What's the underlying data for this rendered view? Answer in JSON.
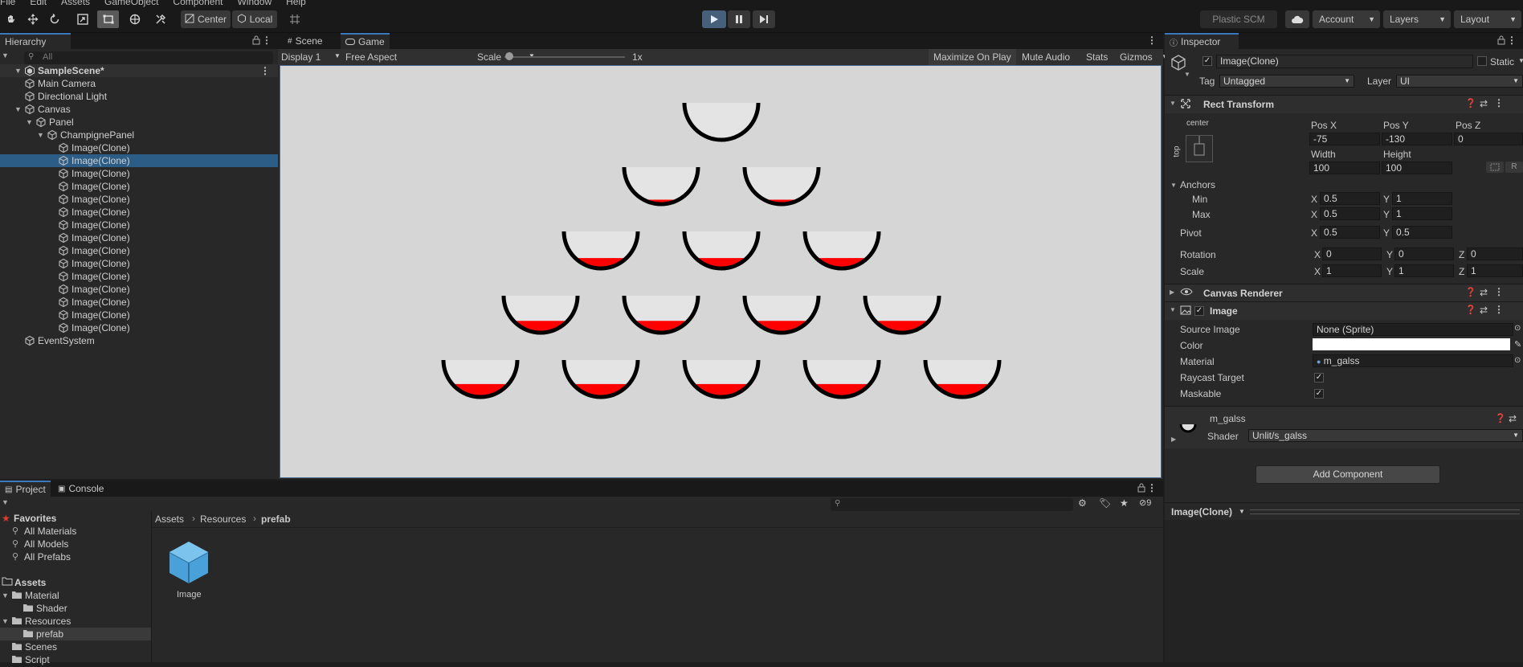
{
  "menubar": {
    "items": [
      "File",
      "Edit",
      "Assets",
      "GameObject",
      "Component",
      "Window",
      "Help"
    ]
  },
  "toolbar": {
    "pivot_center": "Center",
    "pivot_local": "Local",
    "plastic": "Plastic SCM",
    "account": "Account",
    "layers": "Layers",
    "layout": "Layout",
    "play_active": true
  },
  "hierarchy": {
    "tab": "Hierarchy",
    "search_placeholder": "All",
    "scene": "SampleScene*",
    "items": [
      {
        "label": "Main Camera",
        "depth": 1
      },
      {
        "label": "Directional Light",
        "depth": 1
      },
      {
        "label": "Canvas",
        "depth": 1
      },
      {
        "label": "Panel",
        "depth": 2
      },
      {
        "label": "ChampignePanel",
        "depth": 3
      },
      {
        "label": "Image(Clone)",
        "depth": 4
      },
      {
        "label": "Image(Clone)",
        "depth": 4,
        "selected": true
      },
      {
        "label": "Image(Clone)",
        "depth": 4
      },
      {
        "label": "Image(Clone)",
        "depth": 4
      },
      {
        "label": "Image(Clone)",
        "depth": 4
      },
      {
        "label": "Image(Clone)",
        "depth": 4
      },
      {
        "label": "Image(Clone)",
        "depth": 4
      },
      {
        "label": "Image(Clone)",
        "depth": 4
      },
      {
        "label": "Image(Clone)",
        "depth": 4
      },
      {
        "label": "Image(Clone)",
        "depth": 4
      },
      {
        "label": "Image(Clone)",
        "depth": 4
      },
      {
        "label": "Image(Clone)",
        "depth": 4
      },
      {
        "label": "Image(Clone)",
        "depth": 4
      },
      {
        "label": "Image(Clone)",
        "depth": 4
      },
      {
        "label": "Image(Clone)",
        "depth": 4
      },
      {
        "label": "EventSystem",
        "depth": 1
      }
    ]
  },
  "scene_view": {
    "tabs": [
      "Scene",
      "Game"
    ],
    "display": "Display 1",
    "aspect": "Free Aspect",
    "scale_label": "Scale",
    "scale_value": "1x",
    "maximize": "Maximize On Play",
    "mute": "Mute Audio",
    "stats": "Stats",
    "gizmos": "Gizmos",
    "glass_rows": [
      [
        0.0
      ],
      [
        0.12,
        0.12
      ],
      [
        0.28,
        0.28,
        0.28
      ],
      [
        0.32,
        0.32,
        0.32,
        0.32
      ],
      [
        0.35,
        0.35,
        0.35,
        0.35,
        0.35
      ]
    ]
  },
  "project": {
    "tabs": [
      "Project",
      "Console"
    ],
    "favorites_title": "Favorites",
    "favorites": [
      "All Materials",
      "All Models",
      "All Prefabs"
    ],
    "assets_title": "Assets",
    "tree": [
      {
        "label": "Material",
        "depth": 1
      },
      {
        "label": "Shader",
        "depth": 2
      },
      {
        "label": "Resources",
        "depth": 1
      },
      {
        "label": "prefab",
        "depth": 2,
        "selected": true
      },
      {
        "label": "Scenes",
        "depth": 1
      },
      {
        "label": "Script",
        "depth": 1
      }
    ],
    "breadcrumb": [
      "Assets",
      "Resources",
      "prefab"
    ],
    "asset_name": "Image",
    "hidden_count": "9"
  },
  "inspector": {
    "tab": "Inspector",
    "object_name": "Image(Clone)",
    "static_label": "Static",
    "tag_label": "Tag",
    "tag_value": "Untagged",
    "layer_label": "Layer",
    "layer_value": "UI",
    "rect": {
      "title": "Rect Transform",
      "anchor_h": "center",
      "anchor_v": "top",
      "posx_label": "Pos X",
      "posx": "-75",
      "posy_label": "Pos Y",
      "posy": "-130",
      "posz_label": "Pos Z",
      "posz": "0",
      "width_label": "Width",
      "width": "100",
      "height_label": "Height",
      "height": "100",
      "anchors_label": "Anchors",
      "min_label": "Min",
      "min_x": "0.5",
      "min_y": "1",
      "max_label": "Max",
      "max_x": "0.5",
      "max_y": "1",
      "pivot_label": "Pivot",
      "pivot_x": "0.5",
      "pivot_y": "0.5",
      "rotation_label": "Rotation",
      "rot_x": "0",
      "rot_y": "0",
      "rot_z": "0",
      "scale_label": "Scale",
      "scale_x": "1",
      "scale_y": "1",
      "scale_z": "1",
      "axis_x": "X",
      "axis_y": "Y",
      "axis_z": "Z",
      "btn_r": "R"
    },
    "canvas_renderer": {
      "title": "Canvas Renderer"
    },
    "image": {
      "title": "Image",
      "source_label": "Source Image",
      "source": "None (Sprite)",
      "color_label": "Color",
      "color": "#ffffff",
      "material_label": "Material",
      "material": "m_galss",
      "raycast_label": "Raycast Target",
      "maskable_label": "Maskable"
    },
    "material": {
      "name": "m_galss",
      "shader_label": "Shader",
      "shader": "Unlit/s_galss"
    },
    "add_component": "Add Component",
    "preview_label": "Image(Clone)"
  },
  "colors": {
    "accent": "#3a79bb",
    "selection": "#2c5d87",
    "liquid": "#ff0000",
    "game_bg": "#d6d6d6"
  }
}
